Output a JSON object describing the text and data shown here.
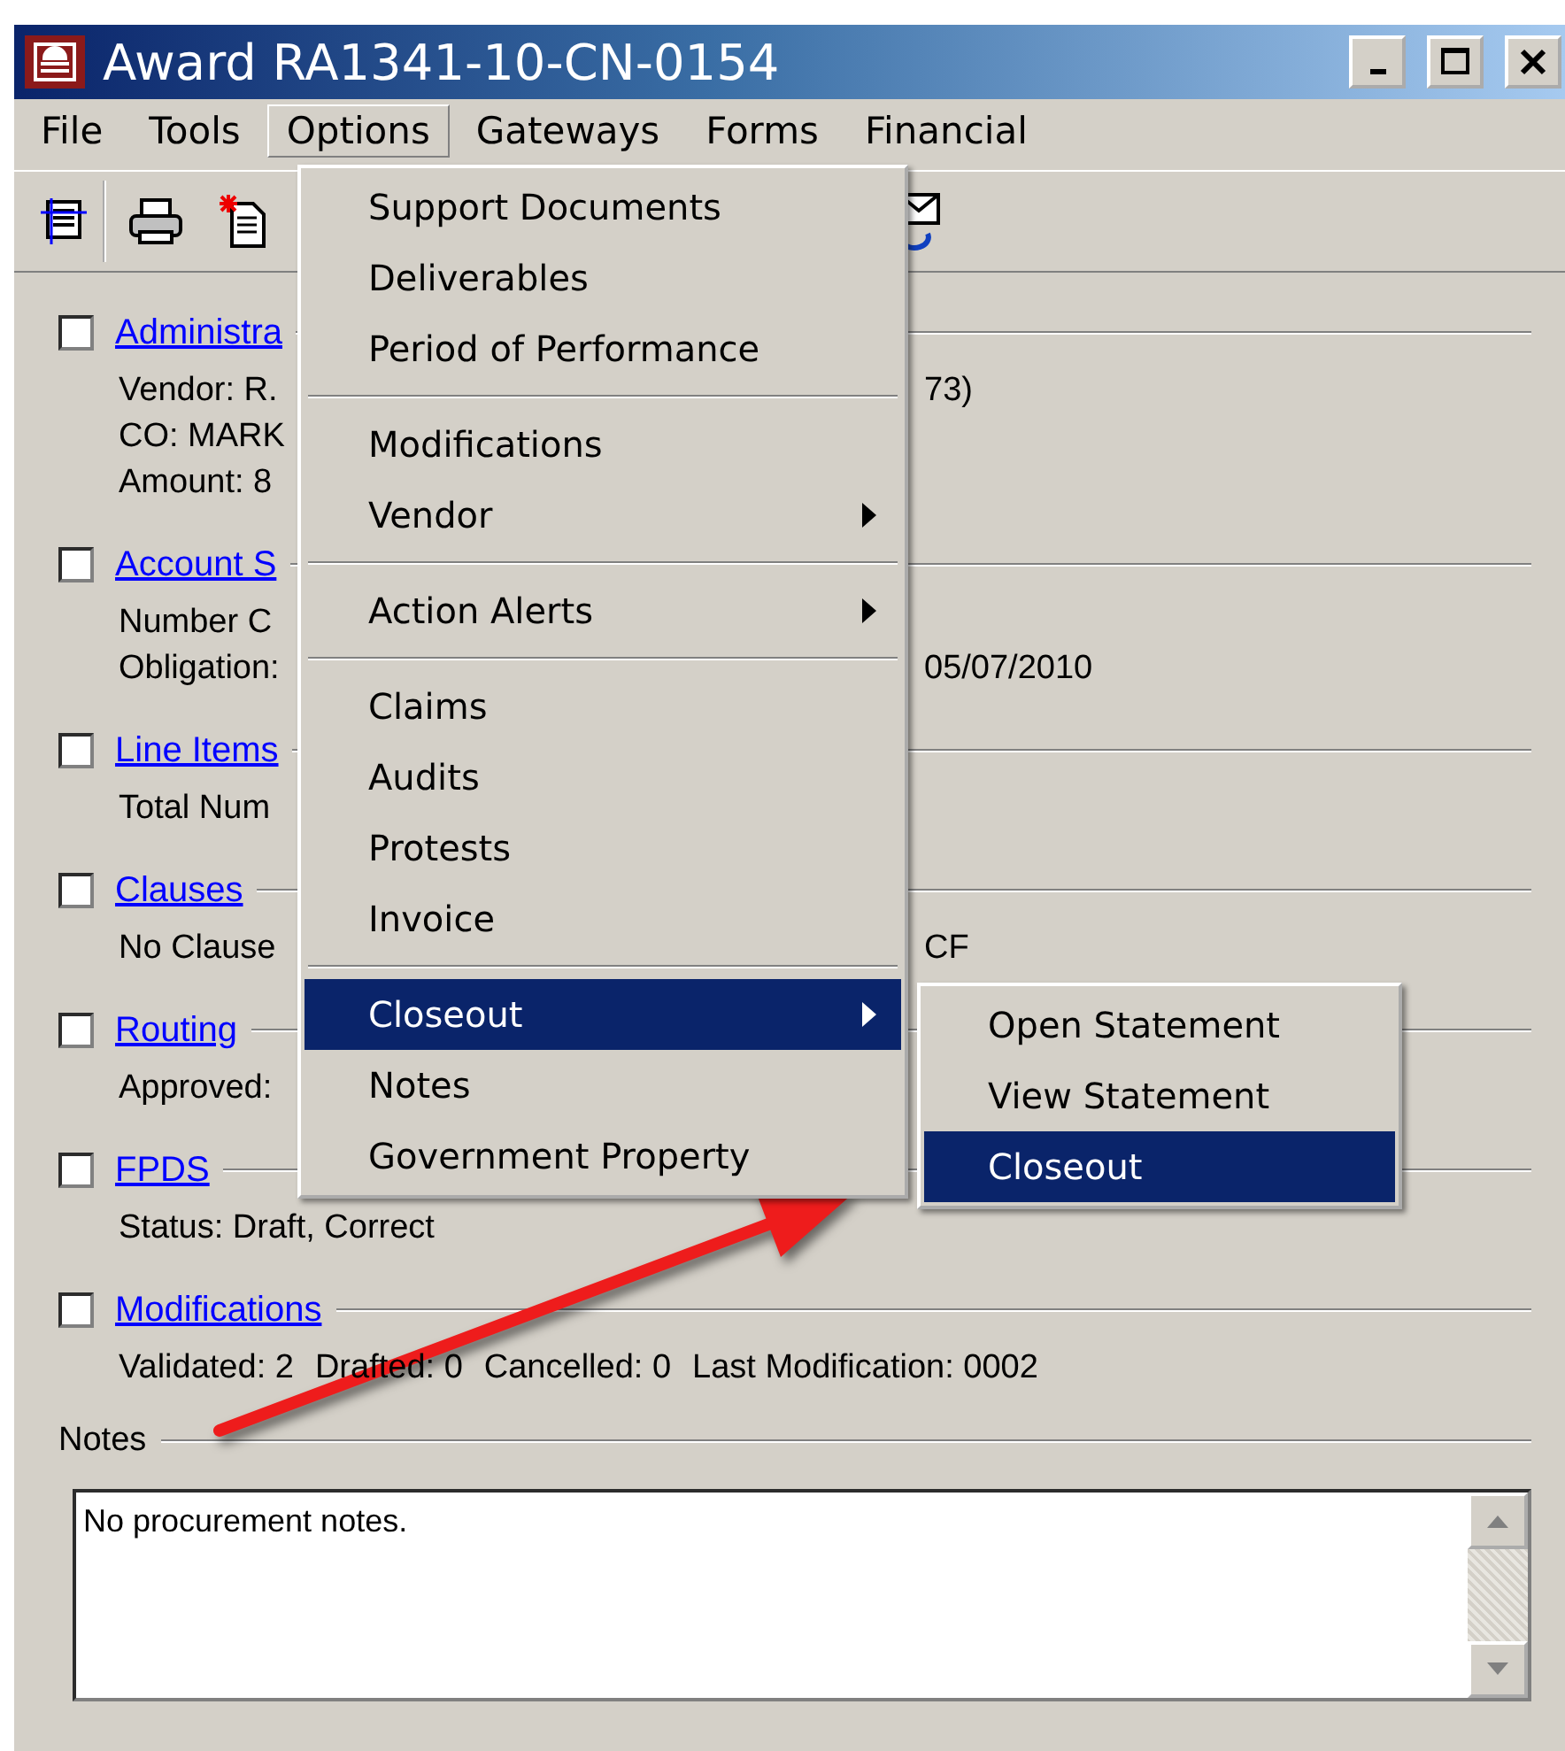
{
  "window": {
    "title": "Award RA1341-10-CN-0154"
  },
  "menubar": [
    {
      "label": "File",
      "selected": false
    },
    {
      "label": "Tools",
      "selected": false
    },
    {
      "label": "Options",
      "selected": true
    },
    {
      "label": "Gateways",
      "selected": false
    },
    {
      "label": "Forms",
      "selected": false
    },
    {
      "label": "Financial",
      "selected": false
    }
  ],
  "sections": [
    {
      "title": "Administra",
      "checked": false,
      "lines": [
        {
          "text": "Vendor: R.",
          "right": "73)"
        },
        {
          "text": "CO: MARK"
        },
        {
          "text": "Amount: 8"
        }
      ]
    },
    {
      "title": "Account S",
      "checked": false,
      "lines": [
        {
          "text": "Number C"
        },
        {
          "text": "Obligation:",
          "right": "05/07/2010"
        }
      ]
    },
    {
      "title": "Line Items",
      "checked": false,
      "lines": [
        {
          "text": "Total Num"
        }
      ]
    },
    {
      "title": "Clauses",
      "checked": false,
      "lines": [
        {
          "text": "No Clause",
          "right": "CF"
        }
      ]
    },
    {
      "title": "Routing",
      "checked": false,
      "lines": [
        {
          "text": "Approved:"
        }
      ]
    },
    {
      "title": "FPDS",
      "checked": false,
      "lines": [
        {
          "text": "Status: Draft, Correct"
        }
      ]
    },
    {
      "title": "Modifications",
      "checked": false,
      "lines": [
        {
          "parts": [
            "Validated: 2",
            "Drafted: 0",
            "Cancelled: 0",
            "Last Modification: 0002"
          ]
        }
      ]
    }
  ],
  "notes": {
    "label": "Notes",
    "value": "No procurement notes."
  },
  "options_menu": [
    {
      "kind": "item",
      "label": "Support Documents",
      "submenu": false,
      "selected": false
    },
    {
      "kind": "item",
      "label": "Deliverables",
      "submenu": false,
      "selected": false
    },
    {
      "kind": "item",
      "label": "Period of Performance",
      "submenu": false,
      "selected": false
    },
    {
      "kind": "separator"
    },
    {
      "kind": "item",
      "label": "Modifications",
      "submenu": false,
      "selected": false
    },
    {
      "kind": "item",
      "label": "Vendor",
      "submenu": true,
      "selected": false
    },
    {
      "kind": "separator"
    },
    {
      "kind": "item",
      "label": "Action Alerts",
      "submenu": true,
      "selected": false
    },
    {
      "kind": "separator"
    },
    {
      "kind": "item",
      "label": "Claims",
      "submenu": false,
      "selected": false
    },
    {
      "kind": "item",
      "label": "Audits",
      "submenu": false,
      "selected": false
    },
    {
      "kind": "item",
      "label": "Protests",
      "submenu": false,
      "selected": false
    },
    {
      "kind": "item",
      "label": "Invoice",
      "submenu": false,
      "selected": false
    },
    {
      "kind": "separator"
    },
    {
      "kind": "item",
      "label": "Closeout",
      "submenu": true,
      "selected": true
    },
    {
      "kind": "item",
      "label": "Notes",
      "submenu": false,
      "selected": false
    },
    {
      "kind": "item",
      "label": "Government Property",
      "submenu": false,
      "selected": false
    }
  ],
  "closeout_submenu": [
    {
      "label": "Open Statement",
      "selected": false
    },
    {
      "label": "View Statement",
      "selected": false
    },
    {
      "label": "Closeout",
      "selected": true
    }
  ]
}
